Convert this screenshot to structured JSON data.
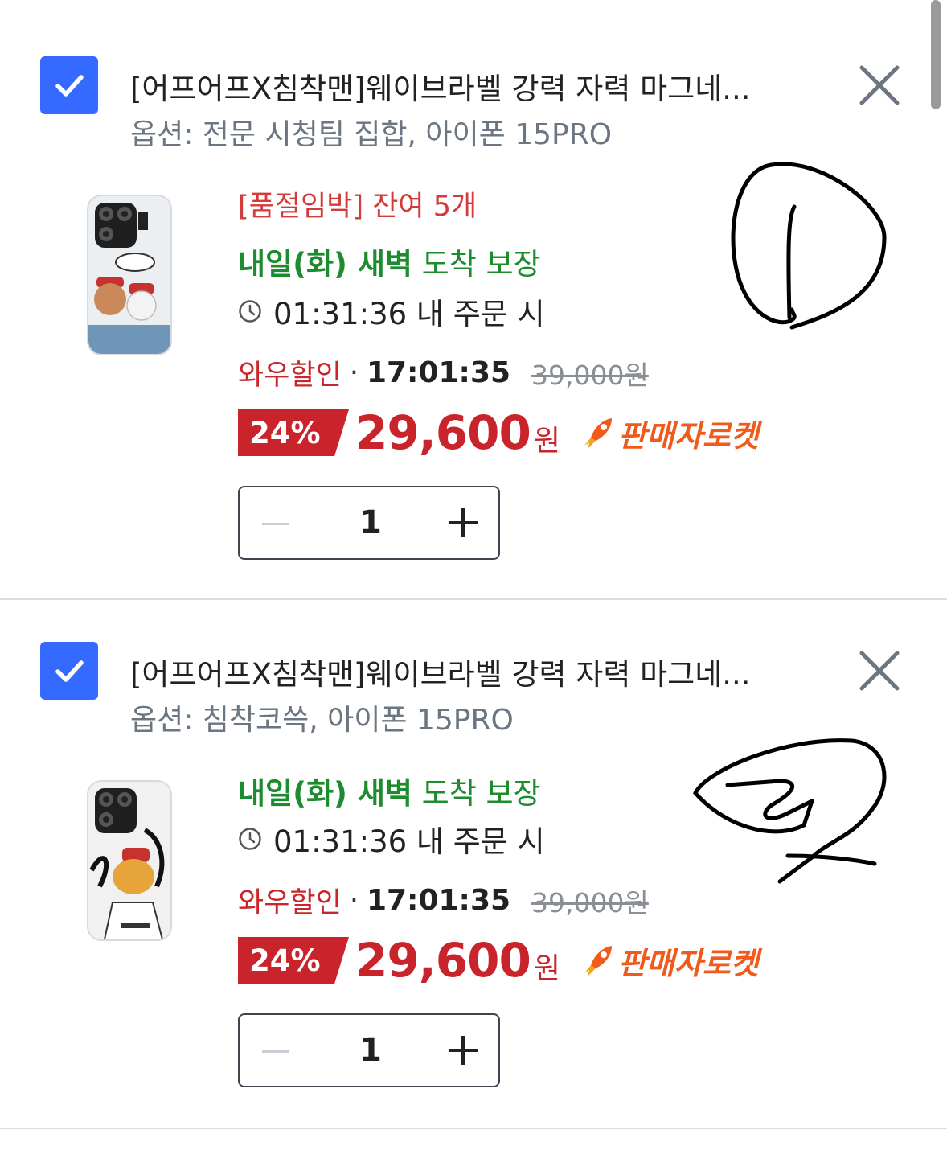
{
  "items": [
    {
      "checked": true,
      "title": "[어프어프X침착맨]웨이브라벨 강력 자력 마그네...",
      "option": "옵션: 전문 시청팀 집합, 아이폰 15PRO",
      "stock_warning": "[품절임박] 잔여 5개",
      "delivery_strong": "내일(화) 새벽",
      "delivery_rest": " 도착 보장",
      "timer": "01:31:36 내 주문 시",
      "wow_label": "와우할인",
      "wow_deadline": "17:01:35",
      "original_price": "39,000원",
      "discount": "24%",
      "price": "29,600",
      "currency": "원",
      "badge": "판매자로켓",
      "quantity": "1",
      "annotation": "1"
    },
    {
      "checked": true,
      "title": "[어프어프X침착맨]웨이브라벨 강력 자력 마그네...",
      "option": "옵션: 침착코쓱, 아이폰 15PRO",
      "delivery_strong": "내일(화) 새벽",
      "delivery_rest": " 도착 보장",
      "timer": "01:31:36 내 주문 시",
      "wow_label": "와우할인",
      "wow_deadline": "17:01:35",
      "original_price": "39,000원",
      "discount": "24%",
      "price": "29,600",
      "currency": "원",
      "badge": "판매자로켓",
      "quantity": "1",
      "annotation": "2"
    }
  ],
  "colors": {
    "checkbox": "#346aff",
    "sale_red": "#c9232c",
    "delivery_green": "#1c8c2e",
    "rocket_orange": "#f05a1a"
  },
  "icons": [
    "checkmark-icon",
    "close-icon",
    "clock-icon",
    "rocket-icon",
    "minus-icon",
    "plus-icon"
  ]
}
